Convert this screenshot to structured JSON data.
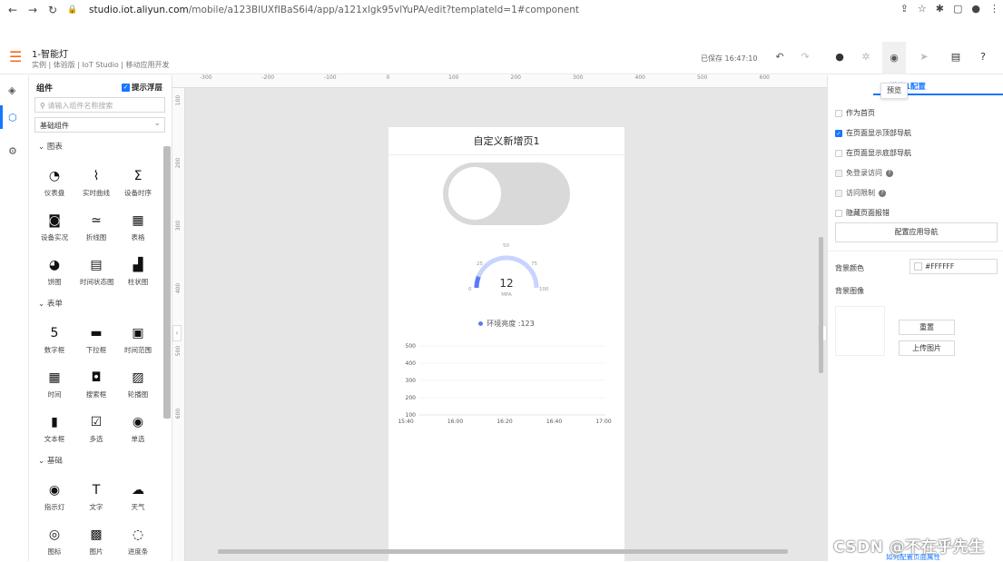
{
  "browser": {
    "url_host": "studio.iot.aliyun.com",
    "url_path": "/mobile/a123BIUXfIBaS6i4/app/a121xlgk95vlYuPA/edit?templateId=1#component"
  },
  "header": {
    "title": "1-智能灯",
    "subtitle": "实例 | 体验版 | IoT Studio | 移动应用开发",
    "saved": "已保存 16:47:10"
  },
  "panel": {
    "title": "组件",
    "float_tip": "提示浮层",
    "search_placeholder": "请输入组件名称搜索",
    "category": "基础组件",
    "sections": [
      "图表",
      "表单",
      "基础"
    ],
    "items": [
      {
        "label": "仪表盘",
        "icon": "gauge-icon",
        "glyph": "◔"
      },
      {
        "label": "实时曲线",
        "icon": "realtime-curve-icon",
        "glyph": "⌇"
      },
      {
        "label": "设备时序",
        "icon": "device-timing-icon",
        "glyph": "Σ"
      },
      {
        "label": "设备实况",
        "icon": "device-live-icon",
        "glyph": "◙"
      },
      {
        "label": "折线图",
        "icon": "line-chart-icon",
        "glyph": "≃"
      },
      {
        "label": "表格",
        "icon": "table-icon",
        "glyph": "▦"
      },
      {
        "label": "饼图",
        "icon": "pie-chart-icon",
        "glyph": "◕"
      },
      {
        "label": "时间状态图",
        "icon": "time-status-icon",
        "glyph": "▤"
      },
      {
        "label": "柱状图",
        "icon": "bar-chart-icon",
        "glyph": "▟"
      },
      {
        "label": "数字框",
        "icon": "number-box-icon",
        "glyph": "5"
      },
      {
        "label": "下拉框",
        "icon": "dropdown-icon",
        "glyph": "▬"
      },
      {
        "label": "时间范围",
        "icon": "time-range-icon",
        "glyph": "▣"
      },
      {
        "label": "时间",
        "icon": "time-icon",
        "glyph": "▦"
      },
      {
        "label": "搜索框",
        "icon": "search-box-icon",
        "glyph": "◘"
      },
      {
        "label": "轮播图",
        "icon": "carousel-icon",
        "glyph": "▨"
      },
      {
        "label": "文本框",
        "icon": "textbox-icon",
        "glyph": "▮"
      },
      {
        "label": "多选",
        "icon": "checkbox-icon",
        "glyph": "☑"
      },
      {
        "label": "单选",
        "icon": "radio-icon",
        "glyph": "◉"
      },
      {
        "label": "指示灯",
        "icon": "indicator-icon",
        "glyph": "◉"
      },
      {
        "label": "文字",
        "icon": "text-icon",
        "glyph": "T"
      },
      {
        "label": "天气",
        "icon": "weather-icon",
        "glyph": "☁"
      },
      {
        "label": "图标",
        "icon": "icon-icon",
        "glyph": "◎"
      },
      {
        "label": "图片",
        "icon": "image-icon",
        "glyph": "▩"
      },
      {
        "label": "进度条",
        "icon": "progress-icon",
        "glyph": "◌"
      }
    ]
  },
  "canvas": {
    "ruler_top": [
      "-300",
      "-200",
      "-100",
      "0",
      "100",
      "200",
      "300",
      "400",
      "500",
      "600"
    ],
    "ruler_left": [
      "100",
      "200",
      "300",
      "400",
      "500",
      "600"
    ]
  },
  "phone": {
    "title": "自定义新增页1",
    "gauge": {
      "value": "12",
      "unit": "MPA",
      "ticks": [
        "0",
        "25",
        "50",
        "75",
        "100"
      ],
      "fraction": 0.12
    },
    "legend": "环境亮度 :123",
    "chart_data": {
      "type": "line",
      "x": [
        "15:40",
        "16:00",
        "16:20",
        "16:40",
        "17:00"
      ],
      "y_ticks": [
        "100",
        "200",
        "300",
        "400",
        "500"
      ],
      "ylim": [
        100,
        500
      ],
      "series": [
        {
          "name": "环境亮度",
          "values": []
        }
      ]
    }
  },
  "rpanel": {
    "tab": "增页1配置",
    "preview_tip": "预览",
    "options": [
      {
        "label": "作为首页",
        "checked": false,
        "disabled": false,
        "help": false
      },
      {
        "label": "在页面显示顶部导航",
        "checked": true,
        "disabled": false,
        "help": false
      },
      {
        "label": "在页面显示底部导航",
        "checked": false,
        "disabled": false,
        "help": false
      },
      {
        "label": "免登录访问",
        "checked": false,
        "disabled": true,
        "help": true
      },
      {
        "label": "访问限制",
        "checked": false,
        "disabled": true,
        "help": true
      },
      {
        "label": "隐藏页面报错",
        "checked": false,
        "disabled": false,
        "help": false
      }
    ],
    "nav_button": "配置应用导航",
    "bg_color_label": "背景颜色",
    "bg_color_value": "#FFFFFF",
    "bg_image_label": "背景图像",
    "reset_button": "重置",
    "upload_button": "上传图片",
    "howto": "如何配置页面属性"
  },
  "watermark": "CSDN @不在乎先生",
  "colors": {
    "accent": "#1677ff",
    "brand": "#f26b1d",
    "gauge": "#5b7cf6"
  }
}
